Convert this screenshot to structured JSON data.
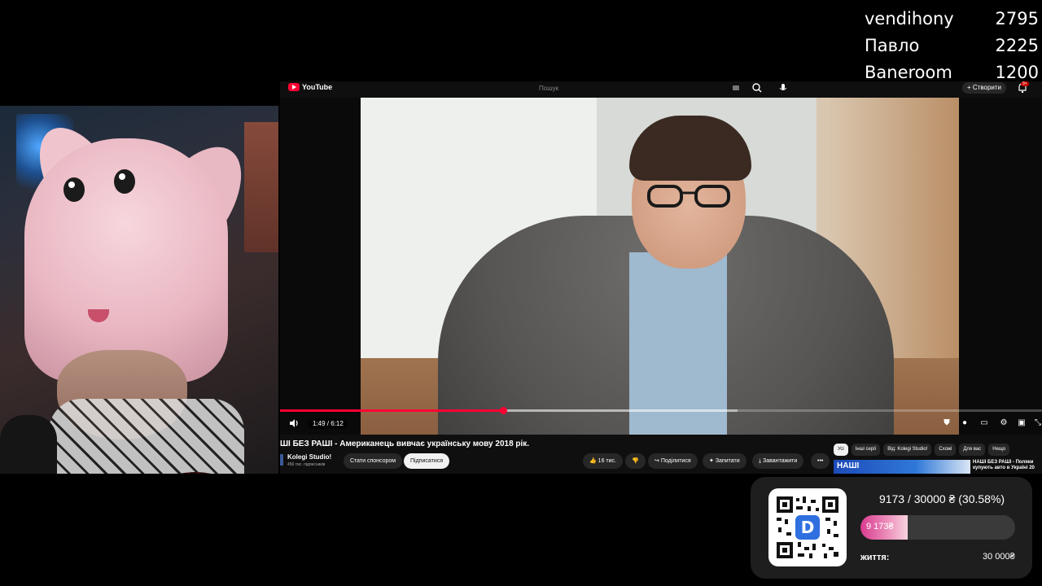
{
  "leaderboard": [
    {
      "name": "vendihony",
      "amount": "2795"
    },
    {
      "name": "Павло",
      "amount": "2225"
    },
    {
      "name": "Baneroom",
      "amount": "1200"
    }
  ],
  "youtube": {
    "logo_text": "YouTube",
    "search_placeholder": "Пошук",
    "create_label": "+ Створити",
    "notif_badge": "9+",
    "player": {
      "time": "1:49 / 6:12",
      "progress": 0.2929,
      "buffered": 0.6
    },
    "video_title": "ШІ БЕЗ РАШІ - Американець вивчає українську мову 2018 рік.",
    "channel": {
      "name": "Kolegi Studio!",
      "verified_icon": "check-circle-icon",
      "subscribers": "456 тис. підписників"
    },
    "buttons": {
      "sponsor": "Стати спонсором",
      "subscribe": "Підписатися",
      "like": "16 тис.",
      "share": "Поділитися",
      "ask": "Запитати",
      "download": "Завантажити",
      "more": "•••"
    },
    "chips": [
      "Усі",
      "Інші серії",
      "Від: Kolegi Studio!",
      "Схожі",
      "Для вас",
      "Нещо"
    ],
    "rec": {
      "thumb_text": "НАШІ",
      "title": "НАШІ БЕЗ РАШІ - Поляки купують авто в Україні 20"
    }
  },
  "donation": {
    "goal_text": "9173 / 30000 ₴ (30.58%)",
    "progress": 0.3058,
    "raised_label": "9 173₴",
    "goal_label": "життя:",
    "target_label": "30 000₴",
    "qr_letter": "D"
  },
  "colors": {
    "youtube_red": "#ff0033",
    "goal_pink": "#d93a8f"
  }
}
